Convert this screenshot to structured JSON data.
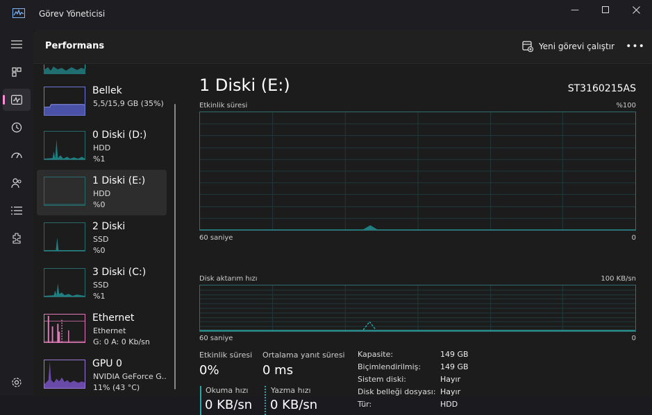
{
  "window": {
    "title": "Görev Yöneticisi",
    "accent": "#ff8fd8"
  },
  "header": {
    "title": "Performans",
    "run_task": "Yeni görevi çalıştır"
  },
  "nav": [
    "hamburger-icon",
    "processes-icon",
    "performance-icon",
    "app-history-icon",
    "startup-icon",
    "users-icon",
    "details-icon",
    "services-icon",
    "settings-icon"
  ],
  "sidebar": {
    "items": [
      {
        "name": "Bellek",
        "l2": "5,5/15,9 GB (35%)",
        "l3": "",
        "color": "#6f7ad8"
      },
      {
        "name": "0 Diski (D:)",
        "l2": "HDD",
        "l3": "%1",
        "color": "#2aa6a8"
      },
      {
        "name": "1 Diski (E:)",
        "l2": "HDD",
        "l3": "%0",
        "color": "#2aa6a8"
      },
      {
        "name": "2 Diski",
        "l2": "SSD",
        "l3": "%0",
        "color": "#2aa6a8"
      },
      {
        "name": "3 Diski (C:)",
        "l2": "SSD",
        "l3": "%1",
        "color": "#2aa6a8"
      },
      {
        "name": "Ethernet",
        "l2": "Ethernet",
        "l3": "G: 0 A: 0 Kb/sn",
        "color": "#e07ab8"
      },
      {
        "name": "GPU 0",
        "l2": "NVIDIA GeForce G...",
        "l3": "11% (43 °C)",
        "color": "#9a7ad8"
      }
    ]
  },
  "main": {
    "title": "1 Diski (E:)",
    "model": "ST3160215AS",
    "graph1": {
      "label": "Etkinlik süresi",
      "max": "%100",
      "time": "60 saniye",
      "min": "0"
    },
    "graph2": {
      "label": "Disk aktarım hızı",
      "max": "100 KB/sn",
      "time": "60 saniye",
      "min": "0"
    },
    "stats": {
      "active_label": "Etkinlik süresi",
      "active_value": "0%",
      "resp_label": "Ortalama yanıt süresi",
      "resp_value": "0 ms",
      "read_label": "Okuma hızı",
      "read_value": "0 KB/sn",
      "write_label": "Yazma hızı",
      "write_value": "0 KB/sn"
    },
    "props": [
      {
        "k": "Kapasite:",
        "v": "149 GB"
      },
      {
        "k": "Biçimlendirilmiş:",
        "v": "149 GB"
      },
      {
        "k": "Sistem diski:",
        "v": "Hayır"
      },
      {
        "k": "Disk belleği dosyası:",
        "v": "Hayır"
      },
      {
        "k": "Tür:",
        "v": "HDD"
      }
    ]
  }
}
